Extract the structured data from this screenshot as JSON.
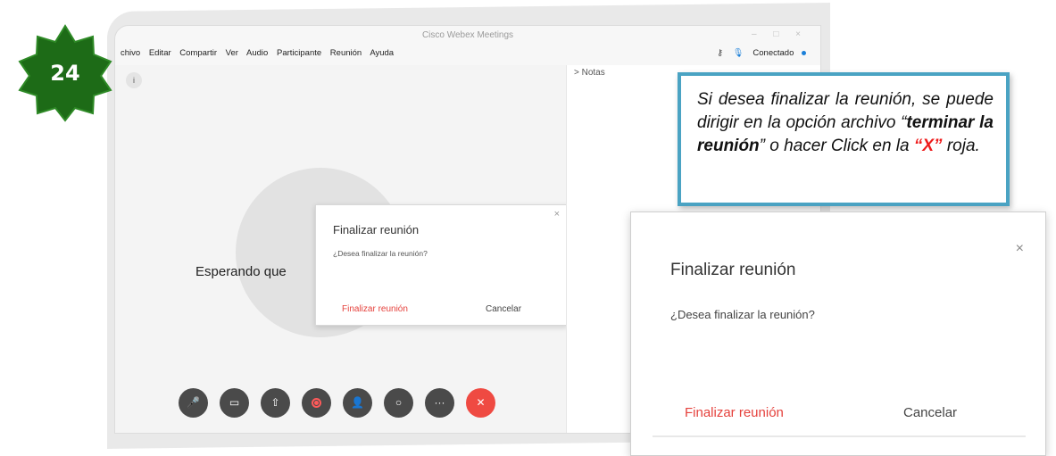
{
  "step_badge": {
    "number": "24",
    "color": "#1d6b17"
  },
  "window": {
    "title": "Cisco Webex Meetings",
    "controls": "– □ ×",
    "menu": [
      "chivo",
      "Editar",
      "Compartir",
      "Ver",
      "Audio",
      "Participante",
      "Reunión",
      "Ayuda"
    ],
    "status_text": "Conectado",
    "key_glyph": "⚷",
    "mic_glyph": "🎙"
  },
  "stage": {
    "info_glyph": "i",
    "waiting_text": "Esperando que"
  },
  "notes": {
    "label": "> Notas"
  },
  "dialog": {
    "close": "×",
    "title": "Finalizar reunión",
    "question": "¿Desea finalizar la reunión?",
    "end_button": "Finalizar reunión",
    "cancel_button": "Cancelar"
  },
  "controls": {
    "mute_glyph": "🎤",
    "video_glyph": "▭",
    "share_glyph": "⇧",
    "participants_glyph": "👤",
    "chat_glyph": "○",
    "more_glyph": "···",
    "leave_glyph": "✕"
  },
  "callout": {
    "text_1": "Si desea finalizar la reunión, se puede dirigir en la opción archivo “",
    "bold": "terminar la reunión",
    "text_2": "” o hacer Click en la ",
    "red": "“X”",
    "text_3": " roja.",
    "border_color": "#4aa3c3"
  },
  "zoom_dialog": {
    "close": "×",
    "title": "Finalizar reunión",
    "question": "¿Desea finalizar la reunión?",
    "end_button": "Finalizar reunión",
    "cancel_button": "Cancelar"
  }
}
